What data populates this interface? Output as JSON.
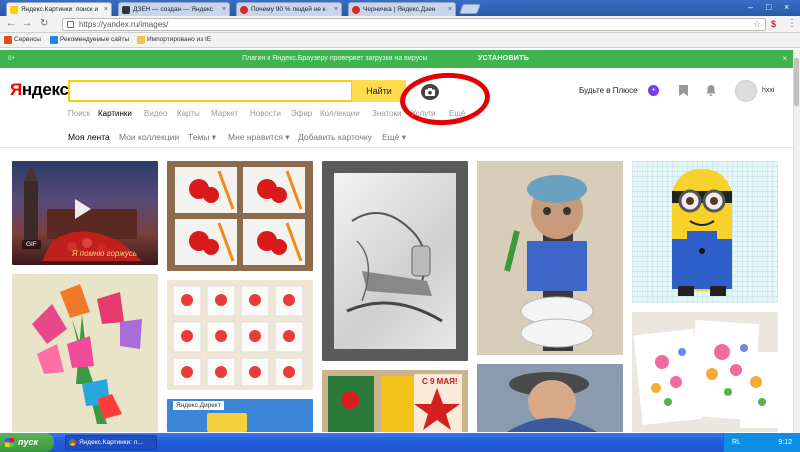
{
  "browser": {
    "tabs": [
      {
        "label": "Яндекс.Картинки: поиск и",
        "active": true,
        "favicon_color": "#ffcc00"
      },
      {
        "label": "ДЗЕН — создан — Яндекс",
        "active": false,
        "favicon_color": "#333333"
      },
      {
        "label": "Почему 90 % людей не к",
        "active": false,
        "favicon_color": "#e02424"
      },
      {
        "label": "Черничка | Яндекс.Дзен",
        "active": false,
        "favicon_color": "#e02424"
      }
    ],
    "url": "https://yandex.ru/images/",
    "bookmarks": [
      {
        "label": "Сервисы",
        "icon_color": "#e34c26"
      },
      {
        "label": "Рекомендуемые сайты",
        "icon_color": "#1e88e5"
      },
      {
        "label": "Импортировано из IE",
        "icon_color": "#f2c14e"
      }
    ]
  },
  "notice": {
    "number": "0+",
    "message": "Плагин к Яндекс.Браузеру проверяет загрузки на вирусы",
    "action": "УСТАНОВИТЬ",
    "bg_color": "#3fb34f"
  },
  "header": {
    "logo_first": "Я",
    "logo_rest": "ндекс",
    "search_value": "",
    "search_button": "Найти",
    "camera_icon": "camera-icon",
    "plus_label": "Будьте в Плюсе",
    "plus_badge": "+",
    "username": "hxxi",
    "accent_color": "#ffdb4d"
  },
  "services": [
    "Поиск",
    "Картинки",
    "Видео",
    "Карты",
    "Маркет",
    "Новости",
    "Эфир",
    "Коллекции",
    "Знатоки",
    "Услуги",
    "Ещё"
  ],
  "active_service": "Картинки",
  "subnav": [
    "Моя лента",
    "Мои коллекции",
    "Темы ▾",
    "Мне нравится ▾",
    "Добавить карточку",
    "Ещё ▾"
  ],
  "cards": {
    "gif_label": "GIF",
    "kremlin_text": "Я помню горжусь",
    "store_caption": "Яндекс.Директ"
  },
  "taskbar": {
    "start": "пуск",
    "window": "Яндекс.Картинки: п...",
    "lang": "RL",
    "clock": "9:12"
  }
}
